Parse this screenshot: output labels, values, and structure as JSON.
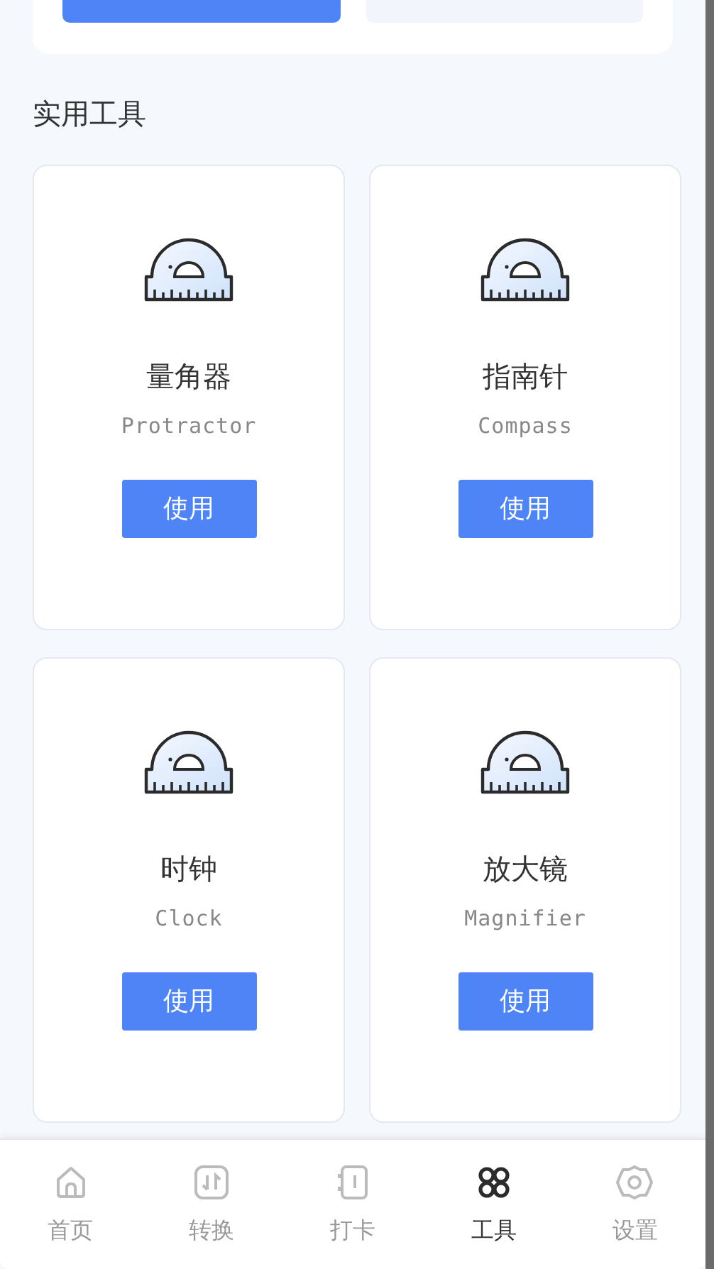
{
  "section_title": "实用工具",
  "tools": [
    {
      "name": "量角器",
      "subtitle": "Protractor",
      "button": "使用"
    },
    {
      "name": "指南针",
      "subtitle": "Compass",
      "button": "使用"
    },
    {
      "name": "时钟",
      "subtitle": "Clock",
      "button": "使用"
    },
    {
      "name": "放大镜",
      "subtitle": "Magnifier",
      "button": "使用"
    }
  ],
  "nav": [
    {
      "kind": "home",
      "label": "首页",
      "selected": false
    },
    {
      "kind": "convert",
      "label": "转换",
      "selected": false
    },
    {
      "kind": "checkin",
      "label": "打卡",
      "selected": false
    },
    {
      "kind": "tools",
      "label": "工具",
      "selected": true
    },
    {
      "kind": "settings",
      "label": "设置",
      "selected": false
    }
  ]
}
